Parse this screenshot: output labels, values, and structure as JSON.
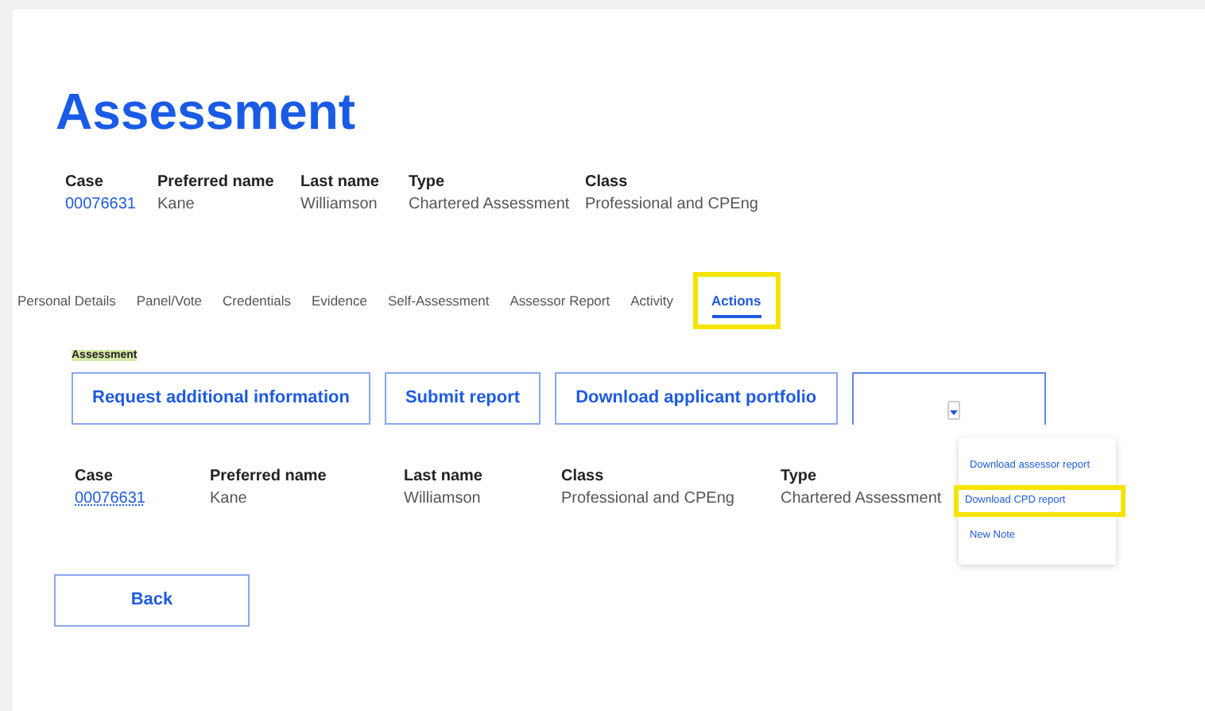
{
  "title": "Assessment",
  "case_summary": [
    {
      "label": "Case",
      "value": "00076631",
      "kind": "link"
    },
    {
      "label": "Preferred name",
      "value": "Kane",
      "kind": "text"
    },
    {
      "label": "Last name",
      "value": "Williamson",
      "kind": "text"
    },
    {
      "label": "Type",
      "value": "Chartered Assessment",
      "kind": "text"
    },
    {
      "label": "Class",
      "value": "Professional and CPEng",
      "kind": "text"
    }
  ],
  "tabs": [
    {
      "label": "Personal Details",
      "selected": false,
      "highlighted": false
    },
    {
      "label": "Panel/Vote",
      "selected": false,
      "highlighted": false
    },
    {
      "label": "Credentials",
      "selected": false,
      "highlighted": false
    },
    {
      "label": "Evidence",
      "selected": false,
      "highlighted": false
    },
    {
      "label": "Self-Assessment",
      "selected": false,
      "highlighted": false
    },
    {
      "label": "Assessor Report",
      "selected": false,
      "highlighted": false
    },
    {
      "label": "Activity",
      "selected": false,
      "highlighted": false
    },
    {
      "label": "Actions",
      "selected": true,
      "highlighted": true
    }
  ],
  "section_label": "Assessment",
  "actions": [
    "Request additional information",
    "Submit report",
    "Download applicant portfolio"
  ],
  "dropdown": {
    "expanded": true,
    "items": [
      {
        "label": "Download assessor report",
        "highlighted": false
      },
      {
        "label": "Download CPD report",
        "highlighted": true
      },
      {
        "label": "New Note",
        "highlighted": false
      }
    ]
  },
  "case_detail": [
    {
      "label": "Case",
      "value": "00076631",
      "kind": "link"
    },
    {
      "label": "Preferred name",
      "value": "Kane",
      "kind": "text"
    },
    {
      "label": "Last name",
      "value": "Williamson",
      "kind": "text"
    },
    {
      "label": "Class",
      "value": "Professional and CPEng",
      "kind": "text"
    },
    {
      "label": "Type",
      "value": "Chartered Assessment",
      "kind": "text"
    }
  ],
  "back_button": "Back"
}
